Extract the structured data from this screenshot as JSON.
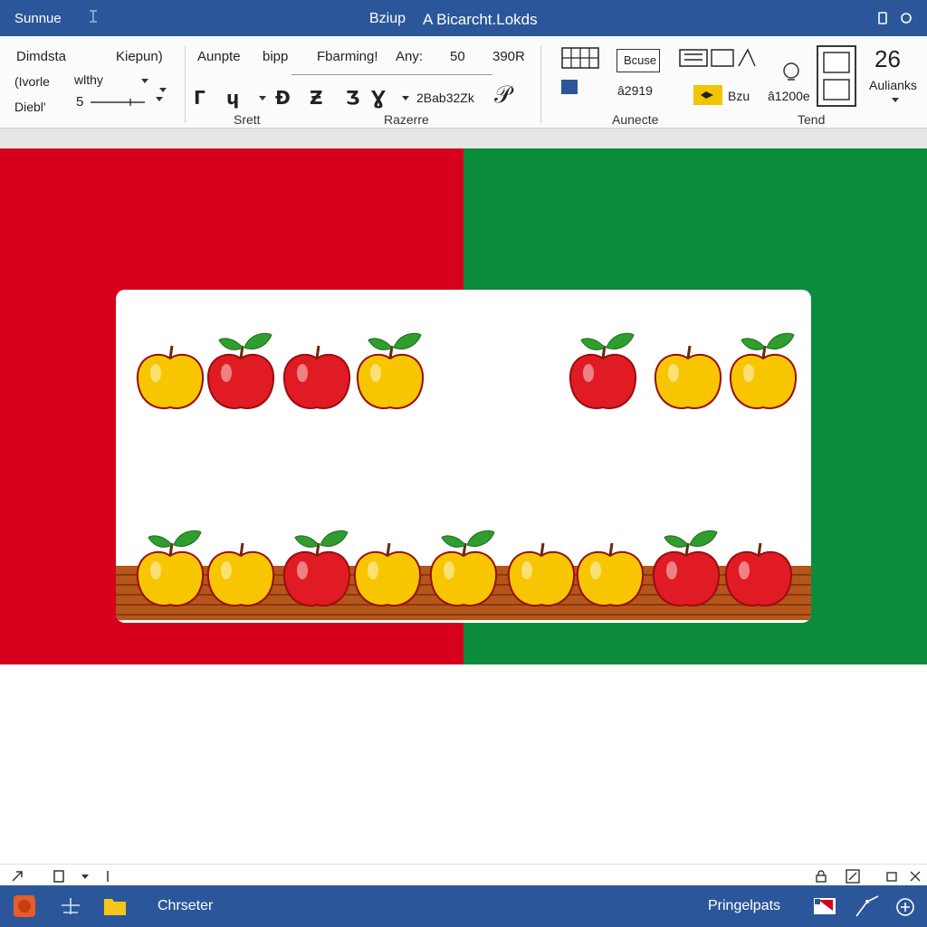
{
  "titlebar": {
    "app_name": "Sunnue",
    "tab": "Bziup",
    "document_title": "A Bicarcht.Lokds"
  },
  "ribbon": {
    "left_group": {
      "row1": [
        "Dimdsta",
        "Kiepun)"
      ],
      "row2": [
        "(Ivorle",
        "wlthy"
      ],
      "row3": [
        "Diebl'",
        "5"
      ]
    },
    "font_group": {
      "labels": [
        "Aunpte",
        "bipp",
        "Fbarming!",
        "Any:",
        "50",
        "390R"
      ],
      "size_value": "2Bab32Zk",
      "group_a": "Srett",
      "group_b": "Razerre"
    },
    "right_group": {
      "style_box": "Bcuse",
      "value_a": "â2919",
      "value_b": "Bzu",
      "value_c": "â1200e",
      "group_c": "Aunecte",
      "group_d": "Tend",
      "number": "26",
      "autolinks": "Aulianks"
    }
  },
  "apples": {
    "top_row": [
      {
        "color": "yellow",
        "leaf": false
      },
      {
        "color": "red",
        "leaf": true
      },
      {
        "color": "red",
        "leaf": false
      },
      {
        "color": "yellow",
        "leaf": true
      },
      {
        "color": "red",
        "leaf": true
      },
      {
        "color": "yellow",
        "leaf": false
      },
      {
        "color": "yellow",
        "leaf": true
      }
    ],
    "shelf_row": [
      {
        "color": "yellow",
        "leaf": true
      },
      {
        "color": "yellow",
        "leaf": false
      },
      {
        "color": "red",
        "leaf": true
      },
      {
        "color": "yellow",
        "leaf": false
      },
      {
        "color": "yellow",
        "leaf": true
      },
      {
        "color": "yellow",
        "leaf": false
      },
      {
        "color": "yellow",
        "leaf": false
      },
      {
        "color": "red",
        "leaf": true
      },
      {
        "color": "red",
        "leaf": false
      }
    ]
  },
  "colors": {
    "titlebar": "#2b579a",
    "canvas_left": "#d6001c",
    "canvas_right": "#0a8c3c",
    "apple_red": "#e01b24",
    "apple_yellow": "#f7c600",
    "leaf": "#2f9e2f",
    "shelf": "#b5561b"
  },
  "taskbar": {
    "left_label": "Chrseter",
    "right_label": "Pringelpats"
  }
}
